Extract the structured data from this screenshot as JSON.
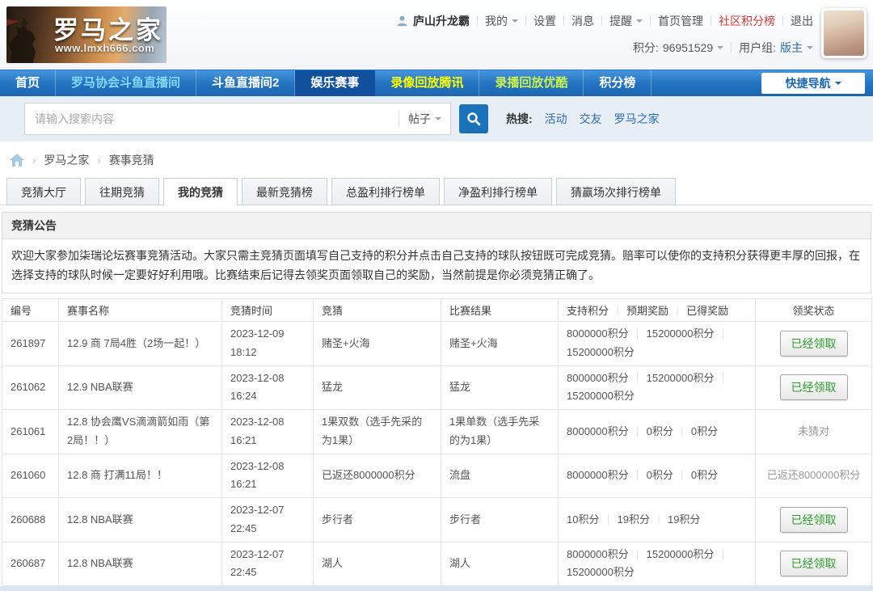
{
  "header": {
    "logo": {
      "title": "罗马之家",
      "subtitle": "www.lmxh666.com"
    },
    "user": {
      "name": "庐山升龙霸",
      "my": "我的",
      "settings": "设置",
      "messages": "消息",
      "alerts": "提醒",
      "home_admin": "首页管理",
      "community_rank": "社区积分榜",
      "logout": "退出",
      "points_label": "积分:",
      "points_value": "96951529",
      "group_label": "用户组:",
      "group_value": "版主"
    }
  },
  "nav": {
    "items": [
      {
        "label": "首页"
      },
      {
        "label": "罗马协会斗鱼直播间"
      },
      {
        "label": "斗鱼直播间2"
      },
      {
        "label": "娱乐赛事"
      },
      {
        "label": "录像回放腾讯"
      },
      {
        "label": "录播回放优酷"
      },
      {
        "label": "积分榜"
      }
    ],
    "active_index": 3,
    "quick_nav": "快捷导航"
  },
  "search": {
    "placeholder": "请输入搜索内容",
    "type_selected": "帖子",
    "hot_label": "热搜:",
    "hot_links": [
      "活动",
      "交友",
      "罗马之家"
    ]
  },
  "breadcrumb": {
    "items": [
      "罗马之家",
      "赛事竞猜"
    ]
  },
  "tabs": {
    "items": [
      "竞猜大厅",
      "往期竞猜",
      "我的竞猜",
      "最新竞猜榜",
      "总盈利排行榜单",
      "净盈利排行榜单",
      "猜赢场次排行榜单"
    ],
    "active_index": 2
  },
  "announcement": {
    "title": "竞猜公告",
    "body": "欢迎大家参加柒瑞论坛赛事竞猜活动。大家只需主竞猜页面填写自己支持的积分并点击自己支持的球队按钮既可完成竞猜。赔率可以使你的支持积分获得更丰厚的回报，在选择支持的球队时候一定要好好利用哦。比赛结束后记得去领奖页面领取自己的奖励，当然前提是你必须竞猜正确了。"
  },
  "table": {
    "headers": {
      "id": "编号",
      "event": "赛事名称",
      "time": "竞猜时间",
      "guess": "竞猜",
      "result": "比赛结果",
      "support": "支持积分",
      "expected": "预期奖励",
      "earned": "已得奖励",
      "status": "领奖状态"
    },
    "rows": [
      {
        "id": "261897",
        "event": "12.9 商 7局4胜（2场一起！）",
        "time": "2023-12-09 18:12",
        "guess": "赌圣+火海",
        "result": "赌圣+火海",
        "support": "8000000积分",
        "expected": "15200000积分",
        "earned": "15200000积分",
        "status": "已经领取"
      },
      {
        "id": "261062",
        "event": "12.9 NBA联赛",
        "time": "2023-12-08 16:24",
        "guess": "猛龙",
        "result": "猛龙",
        "support": "8000000积分",
        "expected": "15200000积分",
        "earned": "15200000积分",
        "status": "已经领取"
      },
      {
        "id": "261061",
        "event": "12.8 协会鹰VS滴滴箭如雨（第2局！！）",
        "time": "2023-12-08 16:21",
        "guess": "1果双数（选手先采的为1果）",
        "result": "1果单数（选手先采的为1果）",
        "support": "8000000积分",
        "expected": "0积分",
        "earned": "0积分",
        "status": "未猜对"
      },
      {
        "id": "261060",
        "event": "12.8 商 打满11局！！",
        "time": "2023-12-08 16:21",
        "guess": "已返还8000000积分",
        "result": "流盘",
        "support": "8000000积分",
        "expected": "0积分",
        "earned": "0积分",
        "status": "已返还8000000积分"
      },
      {
        "id": "260688",
        "event": "12.8 NBA联赛",
        "time": "2023-12-07 22:45",
        "guess": "步行者",
        "result": "步行者",
        "support": "10积分",
        "expected": "19积分",
        "earned": "19积分",
        "status": "已经领取"
      },
      {
        "id": "260687",
        "event": "12.8 NBA联赛",
        "time": "2023-12-07 22:45",
        "guess": "湖人",
        "result": "湖人",
        "support": "8000000积分",
        "expected": "15200000积分",
        "earned": "15200000积分",
        "status": "已经领取"
      }
    ]
  },
  "colors": {
    "nav_blue": "#2575c2",
    "nav_active_blue": "#124f9c",
    "link_blue": "#2b6dad",
    "nav_cyan_link": "#86d8fb",
    "nav_yellow_link": "#fdff00",
    "nav_yellowgreen_link": "#cdf34d",
    "red_link": "#d03a3a",
    "claim_green": "#2e9b2e",
    "search_bar_bg": "#e7eef5"
  }
}
